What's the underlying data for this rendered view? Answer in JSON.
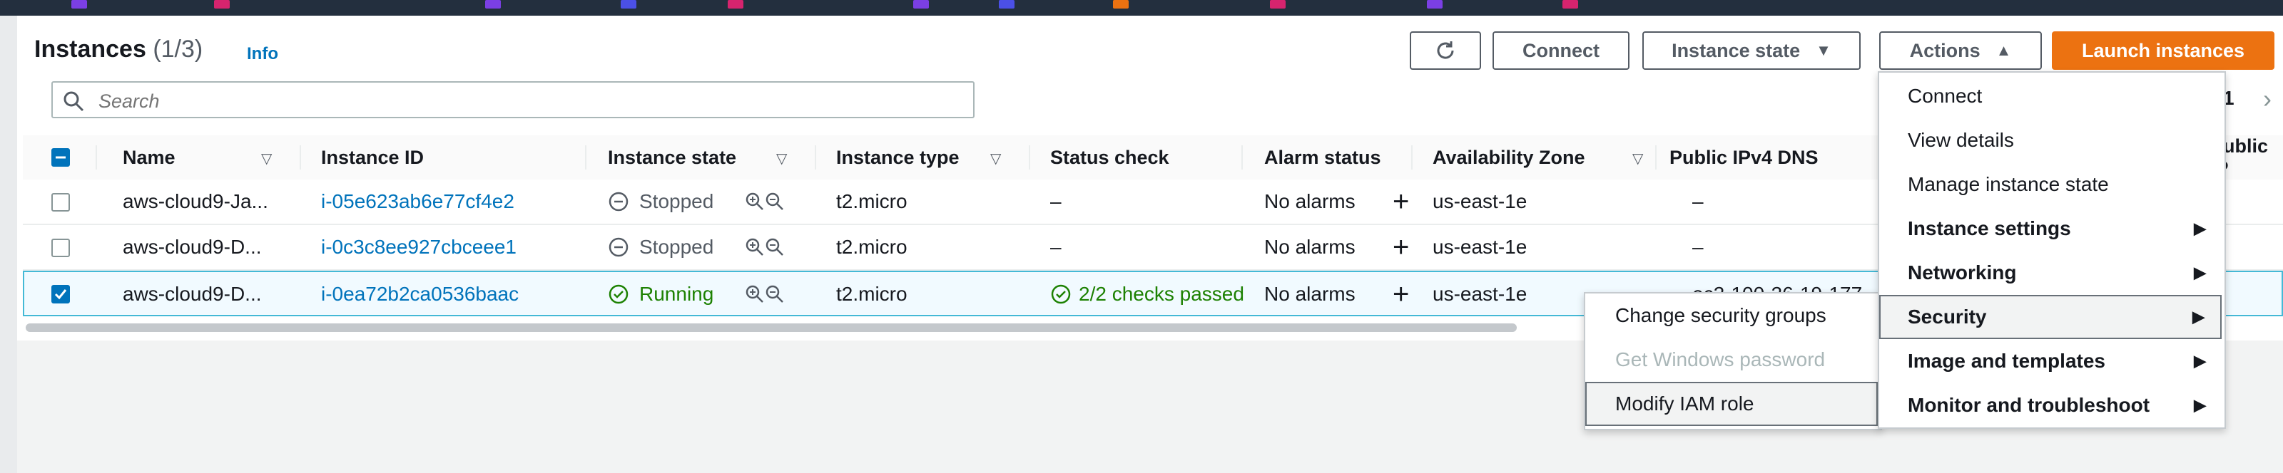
{
  "header": {
    "title": "Instances",
    "count": "(1/3)",
    "info": "Info"
  },
  "toolbar": {
    "connect": "Connect",
    "instance_state": "Instance state",
    "actions": "Actions",
    "launch": "Launch instances"
  },
  "search": {
    "placeholder": "Search"
  },
  "pagination": {
    "page": "1"
  },
  "columns": [
    "Name",
    "Instance ID",
    "Instance state",
    "Instance type",
    "Status check",
    "Alarm status",
    "Availability Zone",
    "Public IPv4 DNS",
    "Public IP"
  ],
  "rows": [
    {
      "name": "aws-cloud9-Ja...",
      "id": "i-05e623ab6e77cf4e2",
      "state": "Stopped",
      "type": "t2.micro",
      "status": "–",
      "alarm": "No alarms",
      "az": "us-east-1e",
      "dns": "–",
      "selected": false
    },
    {
      "name": "aws-cloud9-D...",
      "id": "i-0c3c8ee927cbceee1",
      "state": "Stopped",
      "type": "t2.micro",
      "status": "–",
      "alarm": "No alarms",
      "az": "us-east-1e",
      "dns": "–",
      "selected": false
    },
    {
      "name": "aws-cloud9-D...",
      "id": "i-0ea72b2ca0536baac",
      "state": "Running",
      "type": "t2.micro",
      "status": "2/2 checks passed",
      "alarm": "No alarms",
      "az": "us-east-1e",
      "dns": "ec2-100-26-19-177",
      "selected": true
    }
  ],
  "actions_menu": {
    "items": [
      "Connect",
      "View details",
      "Manage instance state",
      "Instance settings",
      "Networking",
      "Security",
      "Image and templates",
      "Monitor and troubleshoot"
    ]
  },
  "security_menu": {
    "items": [
      "Change security groups",
      "Get Windows password",
      "Modify IAM role"
    ]
  },
  "colors": {
    "accent": "#0073bb",
    "primary": "#ec7211",
    "success": "#1d8102",
    "stopped": "#545b64"
  }
}
